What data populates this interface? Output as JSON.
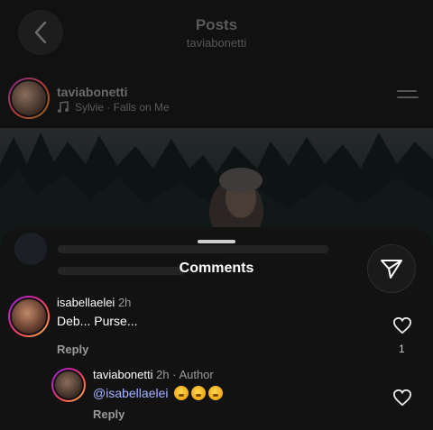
{
  "header": {
    "title": "Posts",
    "subtitle": "taviabonetti"
  },
  "post": {
    "username": "taviabonetti",
    "song": "Sylvie · Falls on Me"
  },
  "sheet": {
    "title": "Comments"
  },
  "comments": [
    {
      "username": "isabellaelei",
      "time": "2h",
      "text": "Deb... Purse...",
      "reply_label": "Reply",
      "like_count": "1"
    },
    {
      "username": "taviabonetti",
      "time": "2h",
      "author_label": "· Author",
      "mention": "@isabellaelei",
      "reply_label": "Reply"
    }
  ],
  "icons": {
    "back": "chevron-left-icon",
    "music": "music-note-icon",
    "menu": "menu-icon",
    "send": "send-icon",
    "heart": "heart-icon",
    "emoji": "shushing-face-emoji"
  },
  "colors": {
    "background": "#121212",
    "mention": "#a5b4ff",
    "secondary_text": "#9a9a9a"
  }
}
